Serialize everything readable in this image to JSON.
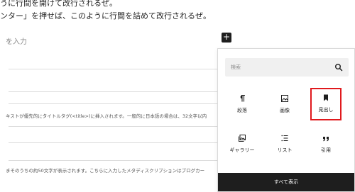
{
  "content": {
    "line1": "うに行間を開けて改行されるぜ。",
    "line2": "ンター」を押せば、このように行間を詰めて改行されるぜ。",
    "title_placeholder": "を入力",
    "desc1": "キストが優先的にタイトルタグ(<title>)に挿入されます。一般的に日本語の場合は、32文字以内",
    "desc2": "まそのうちの約50文字が表示されます。こちらに入力したメタディスクリプションはブログカー"
  },
  "inserter": {
    "add_icon": "plus-icon",
    "search_placeholder": "検索",
    "blocks": [
      {
        "label": "段落",
        "icon": "paragraph-icon"
      },
      {
        "label": "画像",
        "icon": "image-icon"
      },
      {
        "label": "見出し",
        "icon": "bookmark-icon"
      },
      {
        "label": "ギャラリー",
        "icon": "gallery-icon"
      },
      {
        "label": "リスト",
        "icon": "list-icon"
      },
      {
        "label": "引用",
        "icon": "quote-icon"
      }
    ],
    "browse_all": "すべて表示"
  },
  "colors": {
    "highlight": "#e0191d",
    "dark": "#1e1e1e",
    "search_bg": "#f0f0f0"
  }
}
